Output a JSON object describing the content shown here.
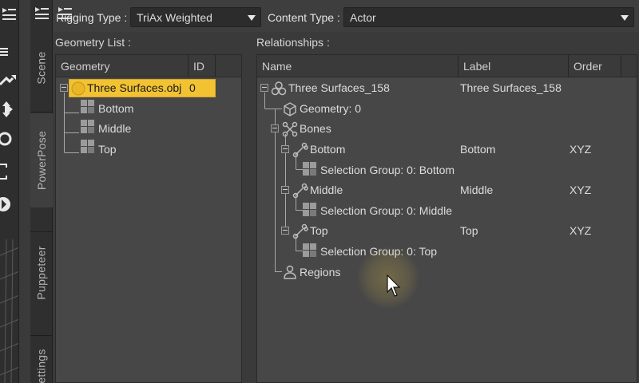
{
  "topbar": {
    "rigging_type_label": "Rigging Type :",
    "rigging_type_value": "TriAx Weighted",
    "content_type_label": "Content Type :",
    "content_type_value": "Actor"
  },
  "side_tabs": [
    "Scene",
    "PowerPose",
    "Puppeteer",
    "ettings"
  ],
  "geometry_list": {
    "title": "Geometry List :",
    "columns": [
      "Geometry",
      "ID"
    ],
    "root": {
      "name": "Three Surfaces.obj",
      "id": "0"
    },
    "children": [
      "Bottom",
      "Middle",
      "Top"
    ]
  },
  "relationships": {
    "title": "Relationships :",
    "columns": [
      "Name",
      "Label",
      "Order"
    ],
    "rows": [
      {
        "name": "Three Surfaces_158",
        "label": "Three Surfaces_158",
        "order": ""
      },
      {
        "name": "Geometry: 0",
        "label": "",
        "order": ""
      },
      {
        "name": "Bones",
        "label": "",
        "order": ""
      },
      {
        "name": "Bottom",
        "label": "Bottom",
        "order": "XYZ"
      },
      {
        "name": "Selection Group: 0: Bottom",
        "label": "",
        "order": ""
      },
      {
        "name": "Middle",
        "label": "Middle",
        "order": "XYZ"
      },
      {
        "name": "Selection Group: 0: Middle",
        "label": "",
        "order": ""
      },
      {
        "name": "Top",
        "label": "Top",
        "order": "XYZ"
      },
      {
        "name": "Selection Group: 0: Top",
        "label": "",
        "order": ""
      },
      {
        "name": "Regions",
        "label": "",
        "order": ""
      }
    ]
  },
  "colors": {
    "selection": "#f2c233",
    "panel": "#474747",
    "header": "#3a3a3a",
    "background": "#3a3a3a"
  },
  "icons": [
    "menu-icon",
    "move-icon",
    "rotate-icon",
    "scale-icon",
    "figure-icon",
    "geometry-cube-icon",
    "bones-icon",
    "bone-icon",
    "selection-group-icon",
    "region-person-icon",
    "dropdown-arrow-icon",
    "mouse-cursor-icon"
  ]
}
